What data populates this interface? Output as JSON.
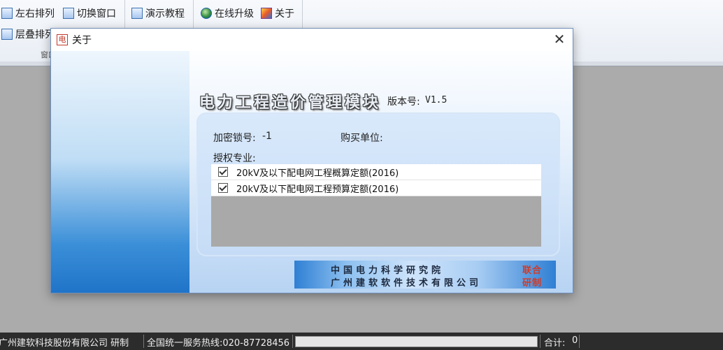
{
  "ribbon": {
    "tile_lr": "左右排列",
    "switch_window": "切换窗口",
    "cascade": "层叠排列",
    "group_window": "窗口",
    "demo": "演示教程",
    "online_upgrade": "在线升级",
    "about": "关于"
  },
  "dialog": {
    "title": "关于",
    "app_icon_char": "电",
    "close_glyph": "✕",
    "product_title": "电力工程造价管理模块",
    "version_label": "版本号:",
    "version_value": "V1.5",
    "lock_label": "加密锁号:",
    "lock_value": "-1",
    "buyer_label": "购买单位:",
    "buyer_value": "",
    "auth_label": "授权专业:",
    "auth_items": [
      {
        "text": "20kV及以下配电网工程概算定额(2016)",
        "checked": true
      },
      {
        "text": "20kV及以下配电网工程预算定额(2016)",
        "checked": true
      }
    ],
    "banner": {
      "line1": "中国电力科学研究院",
      "line2": "广州建软软件技术有限公司",
      "tag1": "联合",
      "tag2": "研制"
    }
  },
  "status": {
    "company": "广州建软科技股份有限公司 研制",
    "hotline": "全国统一服务热线:020-87728456",
    "total_label": "合计:",
    "total_value": "0"
  }
}
